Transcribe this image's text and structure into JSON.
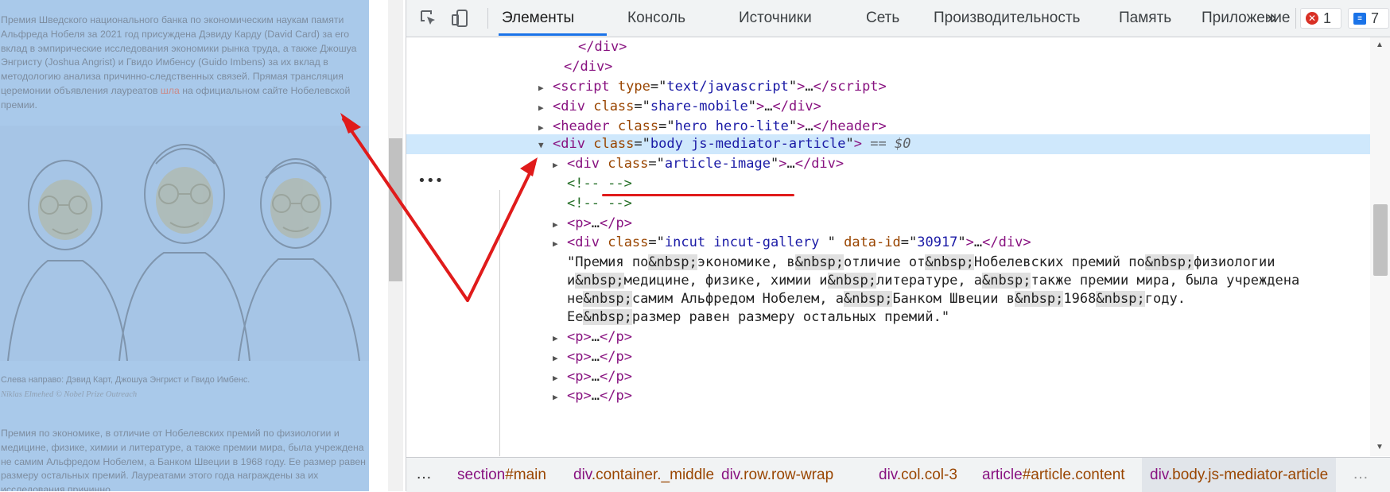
{
  "page": {
    "intro_a": "Премия Шведского национального банка по экономическим наукам памяти Альфреда Нобеля за 2021 год присуждена Дэвиду Карду (David Card) за его вклад в эмпирические исследования экономики рынка труда, а также Джошуа Энгристу (Joshua Angrist) и Гвидо Имбенсу (Guido Imbens) за их вклад в методологию анализа причинно-следственных связей. Прямая трансляция церемонии объявления лауреатов ",
    "intro_hl": "шла",
    "intro_b": " на официальном сайте Нобелевской премии.",
    "caption": "Слева направо: Дэвид Карт, Джошуа Энгрист и Гвидо Имбенс.",
    "credit": "Niklas Elmehed © Nobel Prize Outreach",
    "para2": "Премия по экономике, в отличие от Нобелевских премий по физиологии и медицине, физике, химии и литературе, а также премии мира, была учреждена не самим Альфредом Нобелем, а Банком Швеции в 1968 году. Ее размер равен размеру остальных премий. Лауреатами этого года награждены за их исследования причинно..."
  },
  "devtools": {
    "tabs": [
      "Элементы",
      "Консоль",
      "Источники",
      "Сеть",
      "Производительность",
      "Память",
      "Приложение"
    ],
    "more": "»",
    "errors": "1",
    "messages": "7",
    "tree": {
      "r0": "</div>",
      "r1": "</div>",
      "r2_tag": "script",
      "r2_attr": "type",
      "r2_val": "text/javascript",
      "r3_tag": "div",
      "r3_attr": "class",
      "r3_val": "share-mobile",
      "r4_tag": "header",
      "r4_attr": "class",
      "r4_val": "hero hero-lite",
      "r5_tag": "div",
      "r5_attr": "class",
      "r5_val": "body js-mediator-article",
      "r5_dollar": "== $0",
      "r6_tag": "div",
      "r6_attr": "class",
      "r6_val": "article-image",
      "comment": "<!-- -->",
      "p_tag": "p",
      "r10_tag": "div",
      "r10_attr": "class",
      "r10_val": "incut incut-gallery ",
      "r10_attr2": "data-id",
      "r10_val2": "30917",
      "t1": "\"Премия по",
      "t2": "экономике, в",
      "t3": "отличие от",
      "t4": "Нобелевских премий по",
      "t5": "физиологии",
      "t6": "и",
      "t7": "медицине, физике, химии и",
      "t8": "литературе, а",
      "t9": "также премии мира, была учреждена",
      "t10": "не",
      "t11": "самим Альфредом Нобелем, а",
      "t12": "Банком Швеции в",
      "t13": "1968",
      "t14": "году.",
      "t15": "Ее",
      "t16": "размер равен размеру остальных премий.\"",
      "nbsp": "&nbsp;",
      "ellipsis": "…"
    },
    "breadcrumbs": [
      {
        "tag": "section",
        "rest": "#main"
      },
      {
        "tag": "div",
        "rest": ".container._middle"
      },
      {
        "tag": "div",
        "rest": ".row.row-wrap"
      },
      {
        "tag": "div",
        "rest": ".col.col-3"
      },
      {
        "tag": "article",
        "rest": "#article.content"
      },
      {
        "tag": "div",
        "rest": ".body.js-mediator-article"
      }
    ],
    "crumb_more": "…"
  },
  "colors": {
    "annotation_arrow": "#e01b1b",
    "selection": "#cfe8fc",
    "tab_accent": "#1a73e8"
  }
}
